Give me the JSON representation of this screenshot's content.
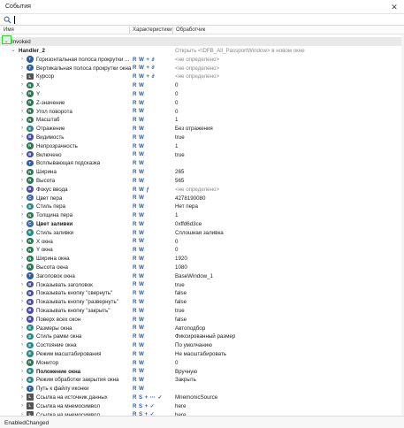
{
  "window": {
    "title": "События"
  },
  "search": {
    "value": "",
    "placeholder": ""
  },
  "columns": {
    "name": "Имя",
    "characteristics": "Характеристики",
    "handler": "Обработчик"
  },
  "status_bar": {
    "text": "EnabledChanged"
  },
  "tree": {
    "group": "Invoked",
    "handler": "Handler_2",
    "handler_value": "Открыть <\\DFB_All_PassportWindow> в новом окне",
    "rows": [
      {
        "name": "Горизонтальная полоса прокрутки ...",
        "chars": "R W + ∂",
        "value": "<не определено>",
        "icon": "t",
        "muted": true
      },
      {
        "name": "Вертикальная полоса прокрутки окна",
        "chars": "R W + ∂",
        "value": "<не определено>",
        "icon": "t",
        "muted": true
      },
      {
        "name": "Курсор",
        "chars": "R W + ∂",
        "value": "<не определено>",
        "icon": "l",
        "muted": true
      },
      {
        "name": "X",
        "chars": "R W",
        "value": "0",
        "icon": "n"
      },
      {
        "name": "Y",
        "chars": "R W",
        "value": "0",
        "icon": "n"
      },
      {
        "name": "Z-значение",
        "chars": "R W",
        "value": "0",
        "icon": "n"
      },
      {
        "name": "Угол поворота",
        "chars": "R W",
        "value": "0",
        "icon": "n"
      },
      {
        "name": "Масштаб",
        "chars": "R W",
        "value": "1",
        "icon": "n"
      },
      {
        "name": "Отражение",
        "chars": "R W",
        "value": "Без отражения",
        "icon": "e"
      },
      {
        "name": "Видимость",
        "chars": "R W",
        "value": "true",
        "icon": "b"
      },
      {
        "name": "Непрозрачность",
        "chars": "R W",
        "value": "1",
        "icon": "n"
      },
      {
        "name": "Включено",
        "chars": "R W",
        "value": "true",
        "icon": "b"
      },
      {
        "name": "Всплывающая подсказка",
        "chars": "R W",
        "value": "",
        "icon": "t"
      },
      {
        "name": "Ширина",
        "chars": "R W",
        "value": "265",
        "icon": "n"
      },
      {
        "name": "Высота",
        "chars": "R W",
        "value": "565",
        "icon": "n"
      },
      {
        "name": "Фокус ввода",
        "chars": "R W ƒ",
        "value": "<не определено>",
        "icon": "b",
        "muted": true
      },
      {
        "name": "Цвет пера",
        "chars": "R W",
        "value": "4278190080",
        "icon": "c"
      },
      {
        "name": "Стиль пера",
        "chars": "R W",
        "value": "Нет пера",
        "icon": "e"
      },
      {
        "name": "Толщина пера",
        "chars": "R W",
        "value": "1",
        "icon": "n"
      },
      {
        "name": "Цвет заливки",
        "chars": "R W",
        "value": "0xffd6d3ce",
        "icon": "c",
        "bold": true
      },
      {
        "name": "Стиль заливки",
        "chars": "R W",
        "value": "Сплошная заливка",
        "icon": "e"
      },
      {
        "name": "X окна",
        "chars": "R W",
        "value": "0",
        "icon": "n"
      },
      {
        "name": "Y окна",
        "chars": "R W",
        "value": "0",
        "icon": "n"
      },
      {
        "name": "Ширина окна",
        "chars": "R W",
        "value": "1920",
        "icon": "n"
      },
      {
        "name": "Высота окна",
        "chars": "R W",
        "value": "1080",
        "icon": "n"
      },
      {
        "name": "Заголовок окна",
        "chars": "R W",
        "value": "BaseWindow_1",
        "icon": "t"
      },
      {
        "name": "Показывать заголовок",
        "chars": "R W",
        "value": "true",
        "icon": "b"
      },
      {
        "name": "Показывать кнопку \"свернуть\"",
        "chars": "R W",
        "value": "false",
        "icon": "b"
      },
      {
        "name": "Показывать кнопку \"развернуть\"",
        "chars": "R W",
        "value": "false",
        "icon": "b"
      },
      {
        "name": "Показывать кнопку \"закрыть\"",
        "chars": "R W",
        "value": "true",
        "icon": "b"
      },
      {
        "name": "Поверх всех окон",
        "chars": "R W",
        "value": "false",
        "icon": "b"
      },
      {
        "name": "Размеры окна",
        "chars": "R W",
        "value": "Автоподбор",
        "icon": "e"
      },
      {
        "name": "Стиль рамки окна",
        "chars": "R W",
        "value": "Фиксированный размер",
        "icon": "e"
      },
      {
        "name": "Состояние окна",
        "chars": "R W",
        "value": "По умолчанию",
        "icon": "e"
      },
      {
        "name": "Режим масштабирования",
        "chars": "R W",
        "value": "Не масштабировать",
        "icon": "e"
      },
      {
        "name": "Монитор",
        "chars": "R W",
        "value": "0",
        "icon": "n"
      },
      {
        "name": "Положение окна",
        "chars": "R W",
        "value": "Вручную",
        "icon": "e",
        "bold": true
      },
      {
        "name": "Режим обработки закрытия окна",
        "chars": "R W",
        "value": "Закрыть",
        "icon": "e"
      },
      {
        "name": "Путь к файлу иконки",
        "chars": "R W",
        "value": "",
        "icon": "t"
      },
      {
        "name": "Ссылка на источник данных",
        "chars": "R S + ⋯ ✓",
        "value": "MnemonicSource",
        "icon": "l"
      },
      {
        "name": "Ссылка на мнемосимвол",
        "chars": "R S + ✓",
        "value": "here",
        "icon": "l"
      },
      {
        "name": "Ссылка на мнемосимвол",
        "chars": "R S + ✓",
        "value": "here",
        "icon": "l"
      }
    ]
  },
  "icons": {
    "search": "search-icon",
    "close": "close-icon",
    "expand": "chevron-right-icon",
    "collapse": "chevron-down-icon"
  }
}
